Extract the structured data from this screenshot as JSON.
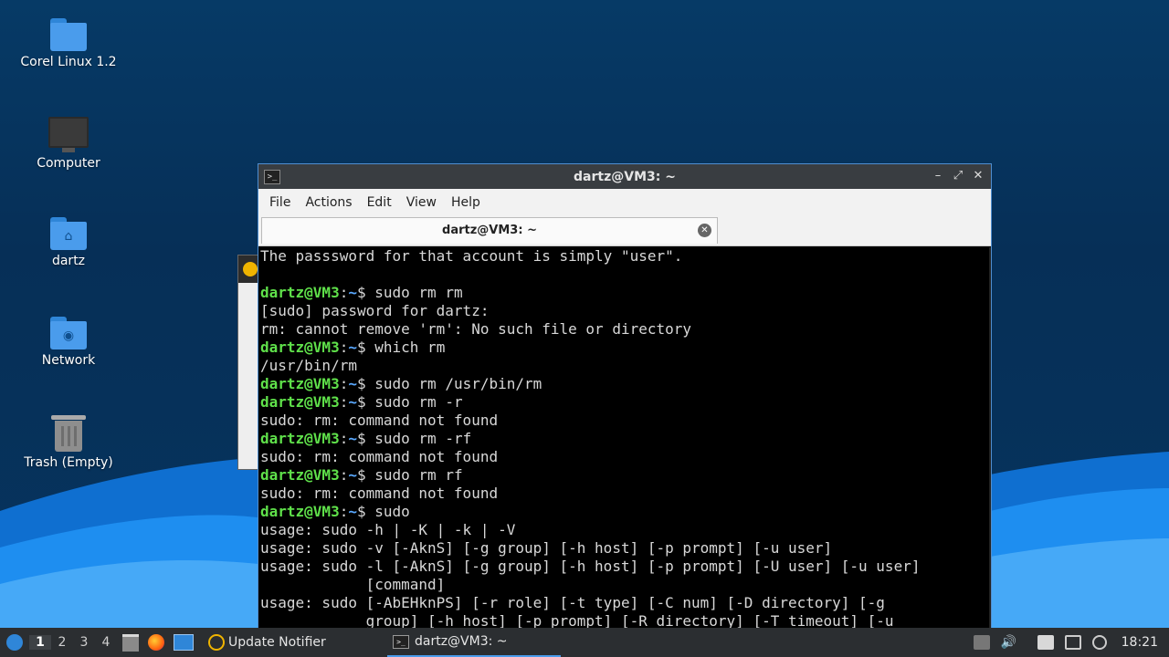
{
  "desktop": {
    "icons": [
      {
        "label": "Corel Linux 1.2",
        "icon": "folder-icon"
      },
      {
        "label": "Computer",
        "icon": "computer-icon"
      },
      {
        "label": "dartz",
        "icon": "home-folder-icon"
      },
      {
        "label": "Network",
        "icon": "network-folder-icon"
      },
      {
        "label": "Trash (Empty)",
        "icon": "trash-icon"
      }
    ]
  },
  "terminal": {
    "window_title": "dartz@VM3: ~",
    "menu": [
      "File",
      "Actions",
      "Edit",
      "View",
      "Help"
    ],
    "tab_label": "dartz@VM3: ~",
    "prompt_user": "dartz@VM3",
    "prompt_path": "~",
    "lines": [
      {
        "type": "out",
        "text": "The passsword for that account is simply \"user\"."
      },
      {
        "type": "out",
        "text": ""
      },
      {
        "type": "cmd",
        "text": " sudo rm rm"
      },
      {
        "type": "out",
        "text": "[sudo] password for dartz:"
      },
      {
        "type": "out",
        "text": "rm: cannot remove 'rm': No such file or directory"
      },
      {
        "type": "cmd",
        "text": " which rm"
      },
      {
        "type": "out",
        "text": "/usr/bin/rm"
      },
      {
        "type": "cmd",
        "text": " sudo rm /usr/bin/rm"
      },
      {
        "type": "cmd",
        "text": " sudo rm -r"
      },
      {
        "type": "out",
        "text": "sudo: rm: command not found"
      },
      {
        "type": "cmd",
        "text": " sudo rm -rf"
      },
      {
        "type": "out",
        "text": "sudo: rm: command not found"
      },
      {
        "type": "cmd",
        "text": " sudo rm rf"
      },
      {
        "type": "out",
        "text": "sudo: rm: command not found"
      },
      {
        "type": "cmd",
        "text": " sudo"
      },
      {
        "type": "out",
        "text": "usage: sudo -h | -K | -k | -V"
      },
      {
        "type": "out",
        "text": "usage: sudo -v [-AknS] [-g group] [-h host] [-p prompt] [-u user]"
      },
      {
        "type": "out",
        "text": "usage: sudo -l [-AknS] [-g group] [-h host] [-p prompt] [-U user] [-u user]"
      },
      {
        "type": "out",
        "text": "            [command]"
      },
      {
        "type": "out",
        "text": "usage: sudo [-AbEHknPS] [-r role] [-t type] [-C num] [-D directory] [-g"
      },
      {
        "type": "out",
        "text": "            group] [-h host] [-p prompt] [-R directory] [-T timeout] [-u"
      }
    ]
  },
  "taskbar": {
    "workspaces": [
      "1",
      "2",
      "3",
      "4"
    ],
    "active_workspace": "1",
    "tasks": [
      {
        "label": "Update Notifier",
        "icon": "update-notifier-icon"
      },
      {
        "label": "dartz@VM3: ~",
        "icon": "terminal-icon"
      }
    ],
    "clock": "18:21"
  },
  "colors": {
    "desktop_bg": "#062f57",
    "accent": "#4a9cec",
    "prompt_green": "#5fe04a",
    "prompt_blue": "#5aa9ff"
  }
}
